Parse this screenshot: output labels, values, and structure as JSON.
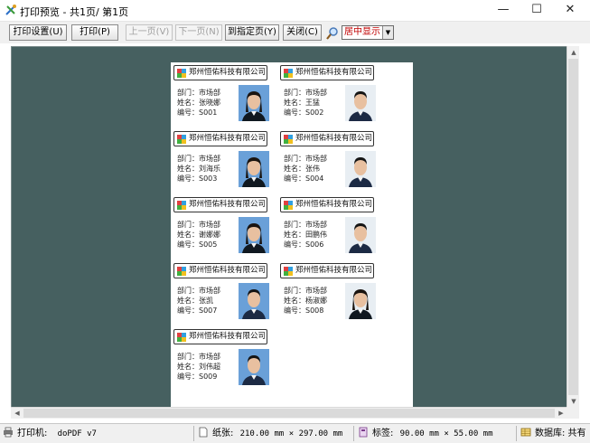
{
  "window": {
    "title": "打印预览 - 共1页/ 第1页",
    "minimize_glyph": "—",
    "maximize_glyph": "☐",
    "close_glyph": "✕"
  },
  "toolbar": {
    "setup_label": "打印设置(U)",
    "print_label": "打印(P)",
    "prev_label": "上一页(V)",
    "next_label": "下一页(N)",
    "goto_label": "到指定页(Y)",
    "close_label": "关闭(C)",
    "zoom_value": "居中显示",
    "zoom_icon": "magnifier-icon"
  },
  "badges": [
    {
      "company": "郑州恒佑科技有限公司",
      "dept": "部门：市场部",
      "name": "姓名：张晓娜",
      "id": "编号：S001",
      "gender": "f"
    },
    {
      "company": "郑州恒佑科技有限公司",
      "dept": "部门：市场部",
      "name": "姓名：王猛",
      "id": "编号：S002",
      "gender": "m"
    },
    {
      "company": "郑州恒佑科技有限公司",
      "dept": "部门：市场部",
      "name": "姓名：刘海乐",
      "id": "编号：S003",
      "gender": "f"
    },
    {
      "company": "郑州恒佑科技有限公司",
      "dept": "部门：市场部",
      "name": "姓名：张伟",
      "id": "编号：S004",
      "gender": "m"
    },
    {
      "company": "郑州恒佑科技有限公司",
      "dept": "部门：市场部",
      "name": "姓名：谢娜娜",
      "id": "编号：S005",
      "gender": "f"
    },
    {
      "company": "郑州恒佑科技有限公司",
      "dept": "部门：市场部",
      "name": "姓名：田鹏伟",
      "id": "编号：S006",
      "gender": "m"
    },
    {
      "company": "郑州恒佑科技有限公司",
      "dept": "部门：市场部",
      "name": "姓名：张凯",
      "id": "编号：S007",
      "gender": "m"
    },
    {
      "company": "郑州恒佑科技有限公司",
      "dept": "部门：市场部",
      "name": "姓名：杨淑娜",
      "id": "编号：S008",
      "gender": "f"
    },
    {
      "company": "郑州恒佑科技有限公司",
      "dept": "部门：市场部",
      "name": "姓名：刘伟超",
      "id": "编号：S009",
      "gender": "m"
    }
  ],
  "status": {
    "printer_label": "打印机:",
    "printer_value": "doPDF v7",
    "paper_label": "纸张:",
    "paper_value": "210.00 mm × 297.00 mm",
    "label_label": "标签:",
    "label_value": "90.00 mm × 55.00 mm",
    "db_label": "数据库: 共有"
  },
  "colors": {
    "preview_bg": "#466060",
    "zoom_text": "#c00000"
  }
}
